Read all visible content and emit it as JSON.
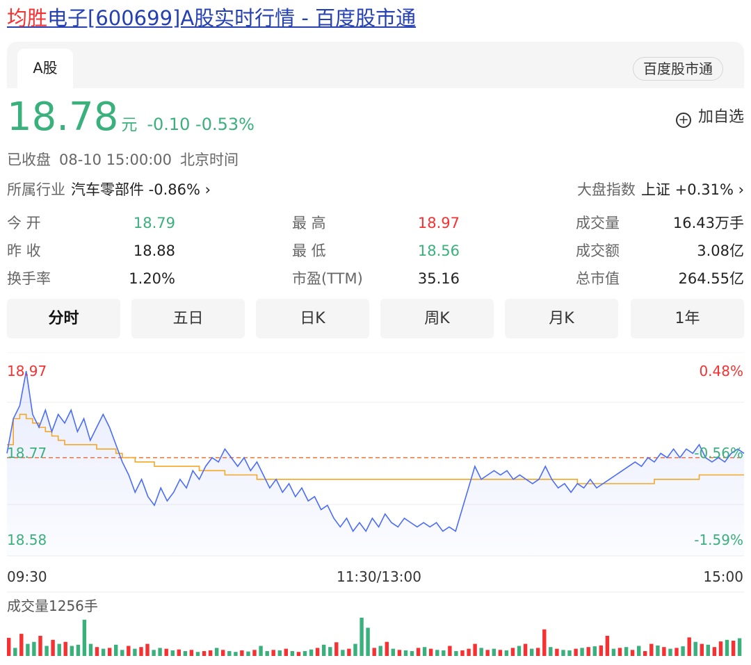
{
  "page": {
    "title_highlight": "均胜",
    "title_rest": "电子[600699]A股实时行情 - 百度股市通"
  },
  "tabs": {
    "active": "A股",
    "brand_pill": "百度股市通"
  },
  "quote": {
    "price": "18.78",
    "unit": "元",
    "change": "-0.10 -0.53%",
    "add_watch": "加自选",
    "status": "已收盘",
    "datetime": "08-10 15:00:00",
    "timezone": "北京时间"
  },
  "industry": {
    "label": "所属行业",
    "value": "汽车零部件 -0.86% ›"
  },
  "index": {
    "label": "大盘指数",
    "value": "上证 +0.31% ›"
  },
  "stats": [
    [
      {
        "label": "今  开",
        "value": "18.79"
      },
      {
        "label": "最  高",
        "value": "18.97"
      },
      {
        "label": "成交量",
        "value": "16.43万手"
      }
    ],
    [
      {
        "label": "昨  收",
        "value": "18.88"
      },
      {
        "label": "最  低",
        "value": "18.56"
      },
      {
        "label": "成交额",
        "value": "3.08亿"
      }
    ],
    [
      {
        "label": "换手率",
        "value": "1.20%"
      },
      {
        "label": "市盈(TTM)",
        "value": "35.16"
      },
      {
        "label": "总市值",
        "value": "264.55亿"
      }
    ]
  ],
  "periods": [
    "分时",
    "五日",
    "日K",
    "周K",
    "月K",
    "1年"
  ],
  "colors": {
    "up": "#f73131",
    "down": "#3ab07c",
    "price_line": "#4a6cf7",
    "avg_line": "#f5a623",
    "prev_close_line": "#f0702e"
  },
  "chart_data": {
    "type": "line",
    "price_labels": {
      "top": "18.97",
      "mid": "18.77",
      "bottom": "18.58"
    },
    "pct_labels": {
      "top": "0.48%",
      "mid": "-0.56%",
      "bottom": "-1.59%"
    },
    "time_labels": [
      "09:30",
      "11:30/13:00",
      "15:00"
    ],
    "ylim": [
      18.58,
      18.97
    ],
    "reference_price": 18.77,
    "series": [
      {
        "values": [
          18.78,
          18.86,
          18.89,
          18.97,
          18.87,
          18.84,
          18.88,
          18.83,
          18.87,
          18.85,
          18.88,
          18.83,
          18.86,
          18.81,
          18.84,
          18.87,
          18.84,
          18.8,
          18.76,
          18.73,
          18.69,
          18.72,
          18.68,
          18.66,
          18.7,
          18.67,
          18.69,
          18.72,
          18.7,
          18.74,
          18.72,
          18.75,
          18.77,
          18.76,
          18.79,
          18.77,
          18.75,
          18.77,
          18.74,
          18.76,
          18.73,
          18.7,
          18.72,
          18.69,
          18.71,
          18.68,
          18.7,
          18.67,
          18.68,
          18.65,
          18.66,
          18.63,
          18.61,
          18.63,
          18.6,
          18.62,
          18.6,
          18.63,
          18.61,
          18.64,
          18.62,
          18.61,
          18.63,
          18.62,
          18.61,
          18.62,
          18.61,
          18.62,
          18.6,
          18.61,
          18.6,
          18.65,
          18.7,
          18.75,
          18.72,
          18.73,
          18.74,
          18.73,
          18.74,
          18.72,
          18.73,
          18.72,
          18.71,
          18.72,
          18.75,
          18.72,
          18.7,
          18.71,
          18.69,
          18.71,
          18.7,
          18.72,
          18.7,
          18.71,
          18.72,
          18.73,
          18.74,
          18.75,
          18.76,
          18.75,
          18.77,
          18.76,
          18.78,
          18.77,
          18.79,
          18.77,
          18.79,
          18.78,
          18.8,
          18.77,
          18.76,
          18.77,
          18.76,
          18.78,
          18.79,
          18.78
        ]
      },
      {
        "values": [
          18.8,
          18.86,
          18.87,
          18.86,
          18.85,
          18.84,
          18.83,
          18.82,
          18.81,
          18.8,
          18.8,
          18.8,
          18.8,
          18.8,
          18.79,
          18.79,
          18.79,
          18.78,
          18.77,
          18.77,
          18.76,
          18.76,
          18.76,
          18.75,
          18.75,
          18.75,
          18.75,
          18.75,
          18.75,
          18.75,
          18.74,
          18.74,
          18.74,
          18.74,
          18.73,
          18.73,
          18.73,
          18.73,
          18.73,
          18.72,
          18.72,
          18.72,
          18.72,
          18.72,
          18.72,
          18.72,
          18.72,
          18.72,
          18.72,
          18.72,
          18.72,
          18.72,
          18.72,
          18.72,
          18.72,
          18.72,
          18.72,
          18.72,
          18.72,
          18.72,
          18.72,
          18.72,
          18.72,
          18.72,
          18.72,
          18.72,
          18.72,
          18.72,
          18.72,
          18.72,
          18.72,
          18.72,
          18.72,
          18.72,
          18.72,
          18.72,
          18.72,
          18.72,
          18.72,
          18.72,
          18.72,
          18.72,
          18.72,
          18.72,
          18.72,
          18.72,
          18.72,
          18.72,
          18.72,
          18.71,
          18.71,
          18.71,
          18.71,
          18.71,
          18.71,
          18.71,
          18.71,
          18.71,
          18.71,
          18.71,
          18.71,
          18.72,
          18.72,
          18.72,
          18.72,
          18.72,
          18.72,
          18.72,
          18.73,
          18.73,
          18.73,
          18.73,
          18.73,
          18.73,
          18.73,
          18.73
        ]
      }
    ],
    "volume_label": "成交量1256手",
    "volume": [
      0.45,
      0.2,
      0.55,
      0.3,
      0.35,
      0.5,
      0.25,
      0.4,
      0.3,
      0.35,
      0.25,
      0.28,
      0.9,
      0.3,
      0.22,
      0.18,
      0.2,
      0.28,
      0.15,
      0.25,
      0.18,
      0.22,
      0.3,
      0.15,
      0.2,
      0.18,
      0.14,
      0.16,
      0.12,
      0.15,
      0.1,
      0.12,
      0.14,
      0.2,
      0.15,
      0.12,
      0.1,
      0.14,
      0.11,
      0.15,
      0.25,
      0.12,
      0.15,
      0.14,
      0.18,
      0.12,
      0.1,
      0.12,
      0.16,
      0.2,
      0.28,
      0.22,
      0.34,
      0.15,
      0.18,
      0.3,
      0.95,
      0.7,
      0.2,
      0.25,
      0.35,
      0.18,
      0.15,
      0.14,
      0.12,
      0.2,
      0.22,
      0.18,
      0.15,
      0.14,
      0.25,
      0.12,
      0.14,
      0.18,
      0.3,
      0.2,
      0.15,
      0.18,
      0.15,
      0.14,
      0.2,
      0.25,
      0.3,
      0.18,
      0.2,
      0.66,
      0.22,
      0.18,
      0.15,
      0.14,
      0.18,
      0.2,
      0.22,
      0.24,
      0.26,
      0.5,
      0.18,
      0.2,
      0.22,
      0.15,
      0.25,
      0.12,
      0.3,
      0.26,
      0.22,
      0.18,
      0.2,
      0.24,
      0.46,
      0.35,
      0.3,
      0.28,
      0.22,
      0.36,
      0.4,
      0.38,
      0.44
    ],
    "volume_up": [
      1,
      0,
      1,
      0,
      0,
      1,
      0,
      1,
      0,
      1,
      0,
      0,
      0,
      0,
      1,
      0,
      1,
      0,
      0,
      1,
      0,
      1,
      1,
      0,
      0,
      1,
      0,
      1,
      0,
      1,
      0,
      1,
      1,
      0,
      1,
      0,
      0,
      1,
      0,
      1,
      0,
      0,
      1,
      0,
      1,
      0,
      1,
      0,
      0,
      1,
      0,
      0,
      1,
      0,
      1,
      0,
      0,
      0,
      1,
      0,
      1,
      0,
      1,
      0,
      0,
      1,
      0,
      1,
      0,
      0,
      1,
      0,
      1,
      1,
      1,
      0,
      1,
      0,
      1,
      0,
      1,
      0,
      1,
      0,
      1,
      1,
      0,
      1,
      0,
      0,
      1,
      0,
      1,
      0,
      1,
      1,
      0,
      1,
      0,
      1,
      0,
      1,
      1,
      0,
      1,
      0,
      1,
      0,
      1,
      0,
      1,
      0,
      1,
      1,
      0,
      1,
      0
    ]
  }
}
